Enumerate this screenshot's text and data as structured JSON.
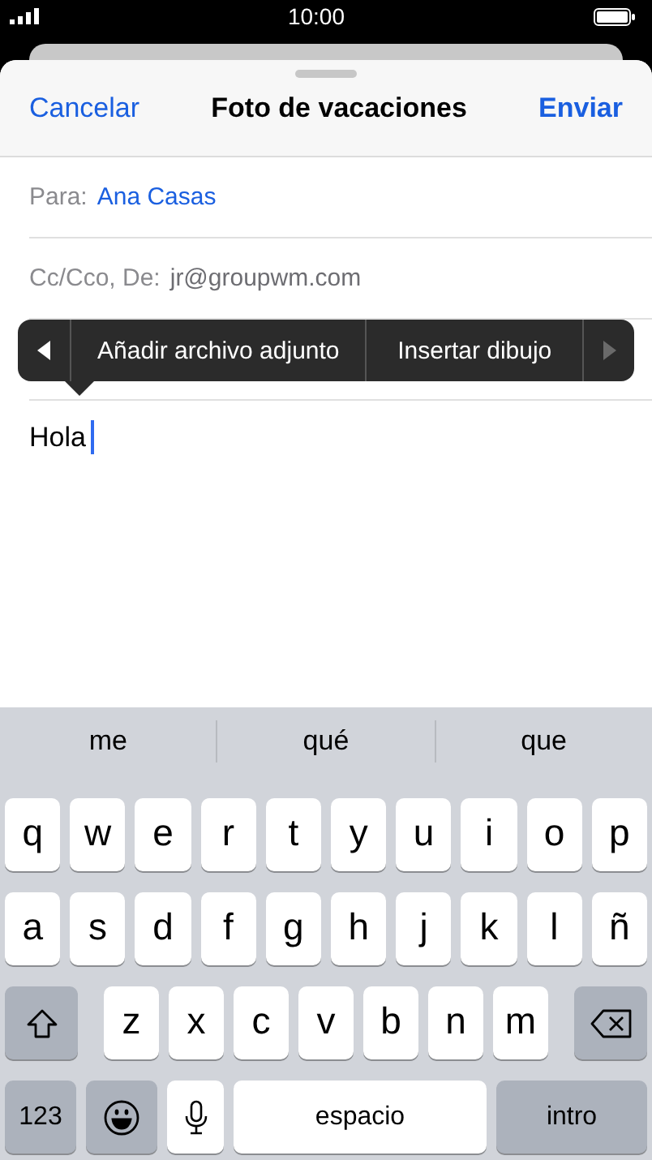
{
  "status_bar": {
    "time": "10:00"
  },
  "nav": {
    "cancel": "Cancelar",
    "title": "Foto de vacaciones",
    "send": "Enviar"
  },
  "fields": [
    {
      "label": "Para:",
      "value": "Ana Casas",
      "kind": "recipient"
    },
    {
      "label": "Cc/Cco, De:",
      "value": "jr@groupwm.com",
      "kind": "sender"
    }
  ],
  "context_menu": {
    "prev": {
      "disabled": false
    },
    "items": [
      "Añadir archivo adjunto",
      "Insertar dibujo"
    ],
    "next": {
      "disabled": true
    }
  },
  "body": {
    "text": "Hola"
  },
  "keyboard": {
    "suggestions": [
      "me",
      "qué",
      "que"
    ],
    "rows": [
      [
        {
          "kind": "letter",
          "label": "q"
        },
        {
          "kind": "letter",
          "label": "w"
        },
        {
          "kind": "letter",
          "label": "e"
        },
        {
          "kind": "letter",
          "label": "r"
        },
        {
          "kind": "letter",
          "label": "t"
        },
        {
          "kind": "letter",
          "label": "y"
        },
        {
          "kind": "letter",
          "label": "u"
        },
        {
          "kind": "letter",
          "label": "i"
        },
        {
          "kind": "letter",
          "label": "o"
        },
        {
          "kind": "letter",
          "label": "p"
        }
      ],
      [
        {
          "kind": "letter",
          "label": "a"
        },
        {
          "kind": "letter",
          "label": "s"
        },
        {
          "kind": "letter",
          "label": "d"
        },
        {
          "kind": "letter",
          "label": "f"
        },
        {
          "kind": "letter",
          "label": "g"
        },
        {
          "kind": "letter",
          "label": "h"
        },
        {
          "kind": "letter",
          "label": "j"
        },
        {
          "kind": "letter",
          "label": "k"
        },
        {
          "kind": "letter",
          "label": "l"
        },
        {
          "kind": "letter",
          "label": "ñ"
        }
      ],
      [
        {
          "kind": "shift"
        },
        {
          "kind": "letter",
          "label": "z"
        },
        {
          "kind": "letter",
          "label": "x"
        },
        {
          "kind": "letter",
          "label": "c"
        },
        {
          "kind": "letter",
          "label": "v"
        },
        {
          "kind": "letter",
          "label": "b"
        },
        {
          "kind": "letter",
          "label": "n"
        },
        {
          "kind": "letter",
          "label": "m"
        },
        {
          "kind": "delete"
        }
      ]
    ],
    "bottom_row": {
      "numbers": "123",
      "space": "espacio",
      "return": "intro"
    }
  }
}
